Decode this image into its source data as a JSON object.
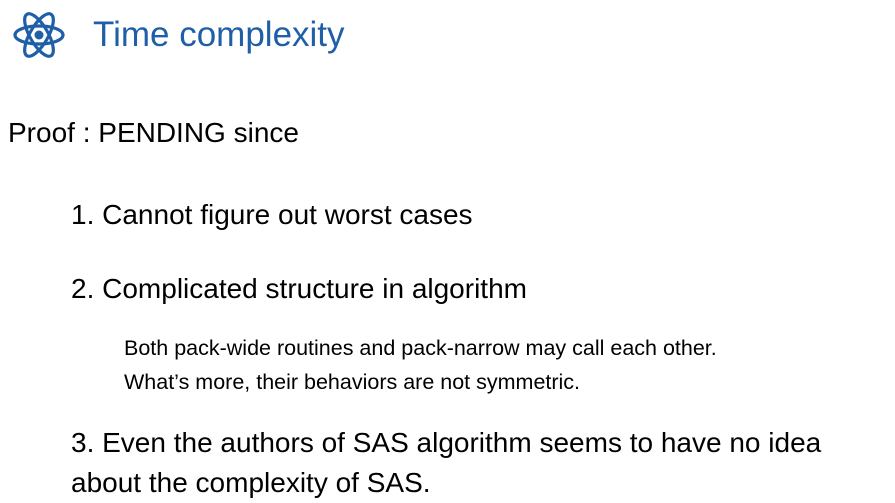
{
  "slide": {
    "icon": "atom-icon",
    "accent_color": "#1f5fa8",
    "title": "Time complexity",
    "intro": "Proof : PENDING since",
    "items": [
      {
        "text": "1. Cannot figure out worst cases"
      },
      {
        "text": "2. Complicated structure in algorithm",
        "note_lines": [
          "Both pack-wide routines and pack-narrow may call each other.",
          "What’s more, their behaviors are not symmetric."
        ]
      },
      {
        "lines": [
          "3. Even the authors of SAS algorithm seems to have no idea",
          "about the complexity of SAS."
        ]
      }
    ]
  }
}
